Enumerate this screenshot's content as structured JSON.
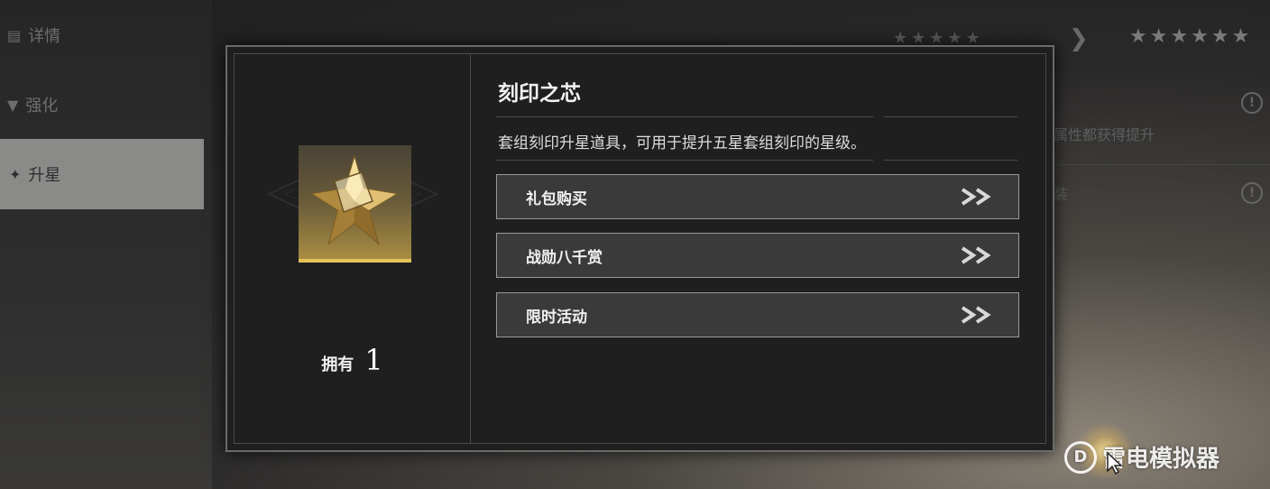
{
  "background": {
    "nav": {
      "details_label": "详情",
      "enhance_label": "强化",
      "upgrade_label": "升星"
    },
    "stars_from": "★★★★★",
    "stars_to": "★★★★★★",
    "row_text_1": "属性都获得提升",
    "row_text_2": "装"
  },
  "modal": {
    "item_name": "刻印之芯",
    "description": "套组刻印升星道具，可用于提升五星套组刻印的星级。",
    "owned_label": "拥有",
    "owned_count": "1",
    "sources": [
      {
        "label": "礼包购买"
      },
      {
        "label": "战勋八千赏"
      },
      {
        "label": "限时活动"
      }
    ]
  },
  "watermark": {
    "text": "雷电模拟器"
  },
  "colors": {
    "accent_gold": "#e2c356",
    "panel_bg": "#1f1f1f",
    "button_bg": "#3a3a3a",
    "button_border": "#9a9a9a"
  },
  "icons": {
    "item": "golden-star-crystal-icon",
    "source_arrow": "double-chevron-right-icon",
    "info": "info-icon",
    "watermark_logo": "ldplayer-logo-icon"
  }
}
